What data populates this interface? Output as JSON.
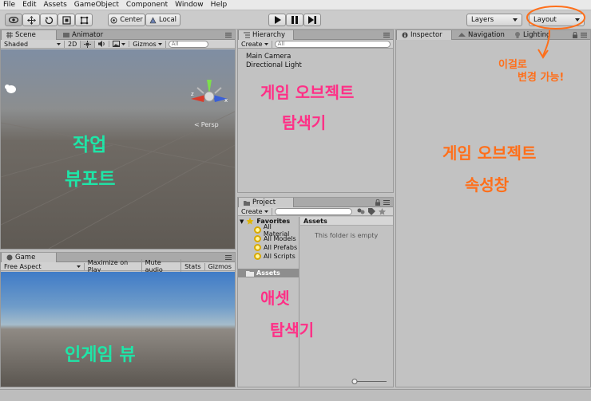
{
  "menu": [
    "File",
    "Edit",
    "Assets",
    "GameObject",
    "Component",
    "Window",
    "Help"
  ],
  "toolbar": {
    "pivot_label": "Center",
    "space_label": "Local",
    "layers_label": "Layers",
    "layout_label": "Layout"
  },
  "scene": {
    "tab_scene": "Scene",
    "tab_animator": "Animator",
    "shading": "Shaded",
    "mode_2d": "2D",
    "gizmos": "Gizmos",
    "search_placeholder": "All",
    "persp": "Persp",
    "annotation_line1": "작업",
    "annotation_line2": "뷰포트"
  },
  "game": {
    "tab": "Game",
    "aspect": "Free Aspect",
    "maximize": "Maximize on Play",
    "mute": "Mute audio",
    "stats": "Stats",
    "gizmos": "Gizmos",
    "annotation": "인게임 뷰"
  },
  "hierarchy": {
    "tab": "Hierarchy",
    "create": "Create",
    "search_placeholder": "All",
    "items": [
      "Main Camera",
      "Directional Light"
    ],
    "annotation_line1": "게임 오브젝트",
    "annotation_line2": "탐색기"
  },
  "project": {
    "tab": "Project",
    "create": "Create",
    "favorites": "Favorites",
    "favorite_items": [
      "All Material",
      "All Models",
      "All Prefabs",
      "All Scripts"
    ],
    "assets_root": "Assets",
    "assets_header": "Assets",
    "empty_message": "This folder is empty",
    "annotation_line1": "애셋",
    "annotation_line2": "탐색기"
  },
  "inspector": {
    "tab_inspector": "Inspector",
    "tab_navigation": "Navigation",
    "tab_lighting": "Lighting",
    "annotation_line1": "게임 오브젝트",
    "annotation_line2": "속성창",
    "layout_note_line1": "이걸로",
    "layout_note_line2": "변경 가능!"
  },
  "colors": {
    "green_annotation": "#1ee6a8",
    "pink_annotation": "#ff2f86",
    "orange_annotation": "#ff6f1a"
  }
}
